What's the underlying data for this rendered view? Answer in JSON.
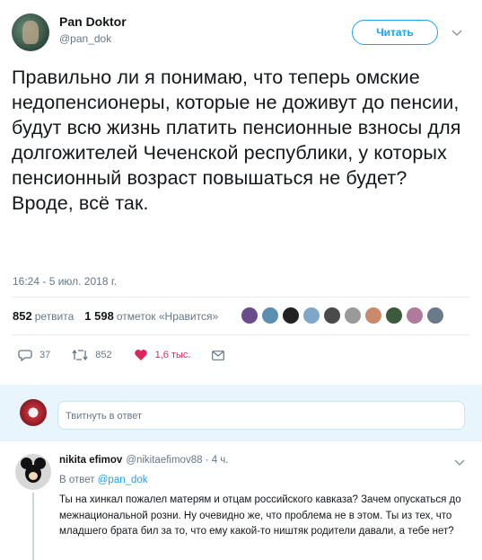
{
  "tweet": {
    "author_name": "Pan Doktor",
    "author_handle": "@pan_dok",
    "follow_label": "Читать",
    "text_lines": [
      "Правильно ли я понимаю, что теперь омские недопенсионеры, которые не доживут до пенсии, будут всю жизнь платить пенсионные взносы для долгожителей Чеченской республики, у которых пенсионный возраст повышаться не будет?",
      "Вроде, всё так."
    ],
    "timestamp": "16:24 - 5 июл. 2018 г.",
    "stats": {
      "retweets_count": "852",
      "retweets_label": "ретвита",
      "likes_count": "1 598",
      "likes_label": "отметок «Нравится»"
    },
    "actions": {
      "replies": "37",
      "retweets": "852",
      "likes": "1,6 тыс."
    }
  },
  "reply_box": {
    "placeholder": "Твитнуть в ответ"
  },
  "comment": {
    "author_name": "nikita efimov",
    "author_handle": "@nikitaefimov88 · 4 ч.",
    "reply_prefix": "В ответ",
    "reply_to": "@pan_dok",
    "text": "Ты на хинкал пожалел матерям и отцам российского кавказа? Зачем опускаться до межнациональной розни. Ну очевидно же, что проблема не в этом. Ты из тех, что младшего брата бил за то, что ему какой-то ништяк родители давали, а тебе нет?"
  },
  "colors": {
    "accent": "#1da1f2",
    "like": "#e0245e",
    "muted": "#657786",
    "reply_bar_bg": "#e8f5fd"
  },
  "liker_colors": [
    "#6a4c8c",
    "#5b8fb0",
    "#222222",
    "#7fa7c9",
    "#4a4a4a",
    "#9a9a9a",
    "#c88a6a",
    "#3d5a3d",
    "#b07a9a",
    "#6a7a8a"
  ]
}
